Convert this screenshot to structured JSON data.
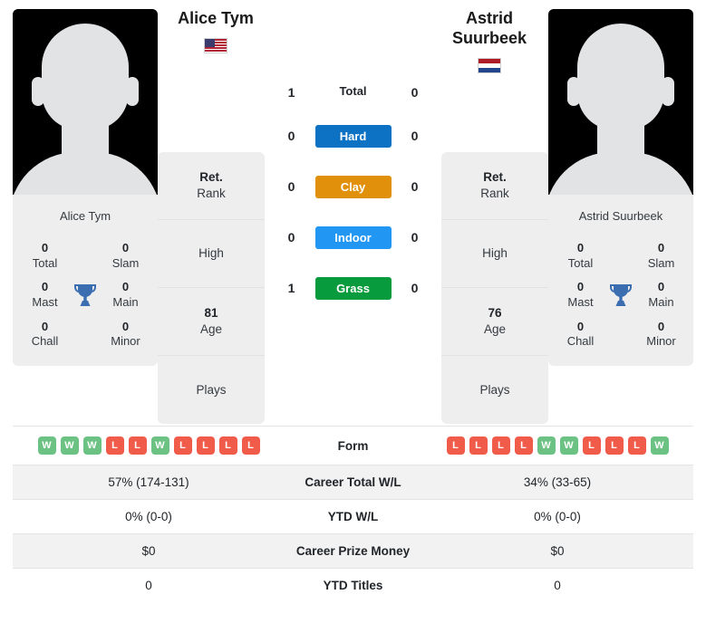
{
  "players": {
    "left": {
      "name": "Alice Tym",
      "flag": "us-flag-icon",
      "photo_caption": "Alice Tym",
      "titles": [
        {
          "value": "0",
          "label": "Total"
        },
        {
          "value": "0",
          "label": "Slam"
        },
        {
          "value": "0",
          "label": "Mast"
        },
        {
          "value": "0",
          "label": "Main"
        },
        {
          "value": "0",
          "label": "Chall"
        },
        {
          "value": "0",
          "label": "Minor"
        }
      ],
      "info": [
        {
          "value": "Ret.",
          "label": "Rank"
        },
        {
          "value": "",
          "label": "High"
        },
        {
          "value": "81",
          "label": "Age"
        },
        {
          "value": "",
          "label": "Plays"
        }
      ]
    },
    "right": {
      "name": "Astrid Suurbeek",
      "name_line1": "Astrid",
      "name_line2": "Suurbeek",
      "flag": "nl-flag-icon",
      "photo_caption": "Astrid Suurbeek",
      "titles": [
        {
          "value": "0",
          "label": "Total"
        },
        {
          "value": "0",
          "label": "Slam"
        },
        {
          "value": "0",
          "label": "Mast"
        },
        {
          "value": "0",
          "label": "Main"
        },
        {
          "value": "0",
          "label": "Chall"
        },
        {
          "value": "0",
          "label": "Minor"
        }
      ],
      "info": [
        {
          "value": "Ret.",
          "label": "Rank"
        },
        {
          "value": "",
          "label": "High"
        },
        {
          "value": "76",
          "label": "Age"
        },
        {
          "value": "",
          "label": "Plays"
        }
      ]
    }
  },
  "head_to_head": {
    "total": {
      "left": "1",
      "label": "Total",
      "right": "0"
    },
    "surfaces": [
      {
        "left": "0",
        "label": "Hard",
        "right": "0",
        "color": "#0d72c4"
      },
      {
        "left": "0",
        "label": "Clay",
        "right": "0",
        "color": "#e0900b"
      },
      {
        "left": "0",
        "label": "Indoor",
        "right": "0",
        "color": "#2196f3"
      },
      {
        "left": "1",
        "label": "Grass",
        "right": "0",
        "color": "#089b3d"
      }
    ]
  },
  "comparison_rows": [
    {
      "label": "Form",
      "type": "form",
      "left_form": [
        "W",
        "W",
        "W",
        "L",
        "L",
        "W",
        "L",
        "L",
        "L",
        "L"
      ],
      "right_form": [
        "L",
        "L",
        "L",
        "L",
        "W",
        "W",
        "L",
        "L",
        "L",
        "W"
      ],
      "striped": false
    },
    {
      "label": "Career Total W/L",
      "type": "text",
      "left": "57% (174-131)",
      "right": "34% (33-65)",
      "striped": true
    },
    {
      "label": "YTD W/L",
      "type": "text",
      "left": "0% (0-0)",
      "right": "0% (0-0)",
      "striped": false
    },
    {
      "label": "Career Prize Money",
      "type": "text",
      "left": "$0",
      "right": "$0",
      "striped": true
    },
    {
      "label": "YTD Titles",
      "type": "text",
      "left": "0",
      "right": "0",
      "striped": false
    }
  ],
  "icons": {
    "trophy": "trophy-icon"
  },
  "colors": {
    "win": "#6cc283",
    "loss": "#f15b4a",
    "trophy": "#3b6eb0",
    "card_bg": "#eeeeee"
  }
}
